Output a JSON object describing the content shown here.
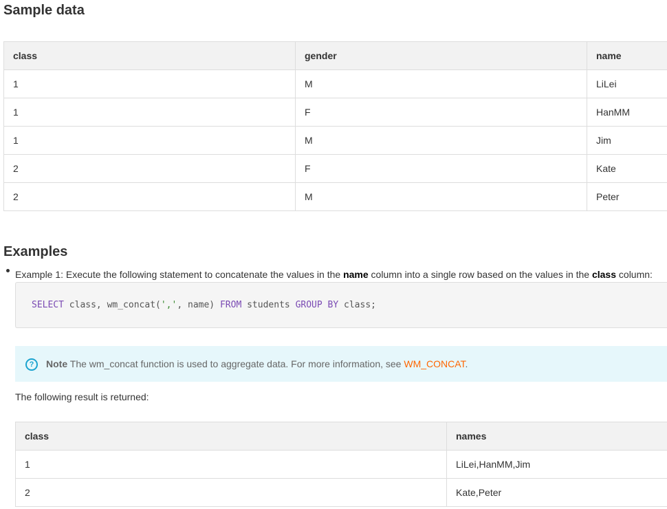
{
  "sample": {
    "title": "Sample data",
    "headers": [
      "class",
      "gender",
      "name"
    ],
    "rows": [
      [
        "1",
        "M",
        "LiLei"
      ],
      [
        "1",
        "F",
        "HanMM"
      ],
      [
        "1",
        "M",
        "Jim"
      ],
      [
        "2",
        "F",
        "Kate"
      ],
      [
        "2",
        "M",
        "Peter"
      ]
    ]
  },
  "examples": {
    "title": "Examples",
    "example1": {
      "prefix": "Example 1: Execute the following statement to concatenate the values in the ",
      "bold1": "name",
      "middle": " column into a single row based on the values in the ",
      "bold2": "class",
      "suffix": " column:"
    },
    "code": {
      "kw_select": "SELECT",
      "part1": " class, wm_concat(",
      "str": "','",
      "part2": ", name) ",
      "kw_from": "FROM",
      "part3": " students ",
      "kw_groupby": "GROUP BY",
      "part4": " class;"
    },
    "note": {
      "icon": "question-circle-icon",
      "label": "Note",
      "text": " The wm_concat function is used to aggregate data. For more information, see ",
      "link": "WM_CONCAT",
      "end": "."
    },
    "result_intro": "The following result is returned:",
    "result": {
      "headers": [
        "class",
        "names"
      ],
      "rows": [
        [
          "1",
          "LiLei,HanMM,Jim"
        ],
        [
          "2",
          "Kate,Peter"
        ]
      ]
    }
  }
}
